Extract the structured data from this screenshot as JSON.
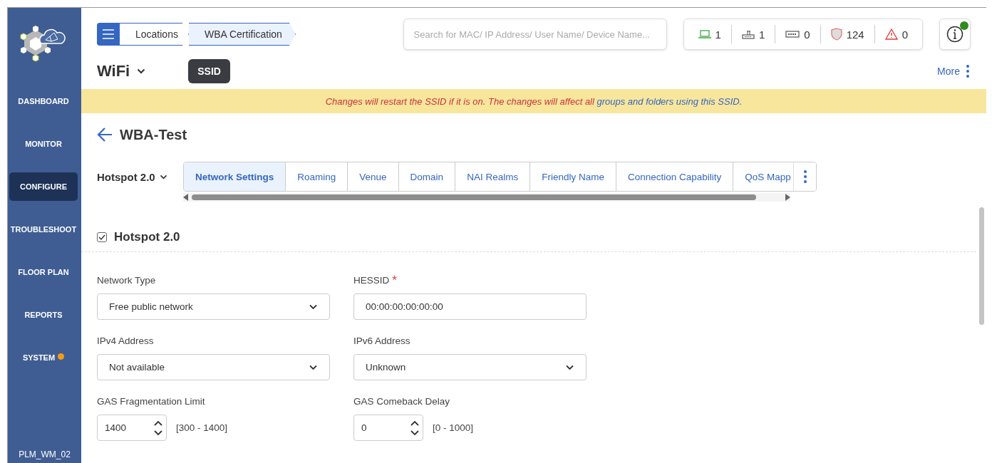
{
  "sidebar": {
    "items": [
      {
        "label": "DASHBOARD",
        "selected": false,
        "notification": false
      },
      {
        "label": "MONITOR",
        "selected": false,
        "notification": false
      },
      {
        "label": "CONFIGURE",
        "selected": true,
        "notification": false
      },
      {
        "label": "TROUBLESHOOT",
        "selected": false,
        "notification": false
      },
      {
        "label": "FLOOR PLAN",
        "selected": false,
        "notification": false
      },
      {
        "label": "REPORTS",
        "selected": false,
        "notification": false
      },
      {
        "label": "SYSTEM",
        "selected": false,
        "notification": true
      }
    ],
    "footer": "PLM_WM_02"
  },
  "header": {
    "breadcrumb": [
      {
        "label": "Locations",
        "selected": false
      },
      {
        "label": "WBA Certification",
        "selected": true
      }
    ],
    "search": {
      "placeholder": "Search for MAC/ IP Address/ User Name/ Device Name..."
    },
    "counters": [
      {
        "kind": "laptop",
        "value": "1"
      },
      {
        "kind": "router",
        "value": "1"
      },
      {
        "kind": "switch",
        "value": "0"
      },
      {
        "kind": "shield",
        "value": "124"
      },
      {
        "kind": "alert",
        "value": "0"
      }
    ],
    "info": {
      "notification": true
    }
  },
  "page": {
    "title": "WiFi",
    "badge": "SSID",
    "more": "More"
  },
  "banner": {
    "message": "Changes will restart the SSID if it is on. The changes will affect all",
    "link": "groups and folders using this SSID."
  },
  "ssid_title": "WBA-Test",
  "profile": "Hotspot 2.0",
  "tabs": [
    {
      "label": "Network Settings",
      "selected": true
    },
    {
      "label": "Roaming",
      "selected": false
    },
    {
      "label": "Venue",
      "selected": false
    },
    {
      "label": "Domain",
      "selected": false
    },
    {
      "label": "NAI Realms",
      "selected": false
    },
    {
      "label": "Friendly Name",
      "selected": false
    },
    {
      "label": "Connection Capability",
      "selected": false
    },
    {
      "label": "QoS Mapp",
      "selected": false
    }
  ],
  "section": {
    "title": "Hotspot 2.0",
    "checked": true
  },
  "fields": [
    {
      "kind": "select",
      "label": "Network Type",
      "value": "Free public network"
    },
    {
      "kind": "text",
      "label": "HESSID",
      "required_mark": "*",
      "value": "00:00:00:00:00:00"
    },
    {
      "kind": "select",
      "label": "IPv4 Address",
      "value": "Not available"
    },
    {
      "kind": "select",
      "label": "IPv6 Address",
      "value": "Unknown"
    },
    {
      "kind": "number",
      "label": "GAS Fragmentation Limit",
      "value": "1400",
      "range": "[300 - 1400]"
    },
    {
      "kind": "number",
      "label": "GAS Comeback Delay",
      "value": "0",
      "range": "[0 - 1000]"
    }
  ]
}
